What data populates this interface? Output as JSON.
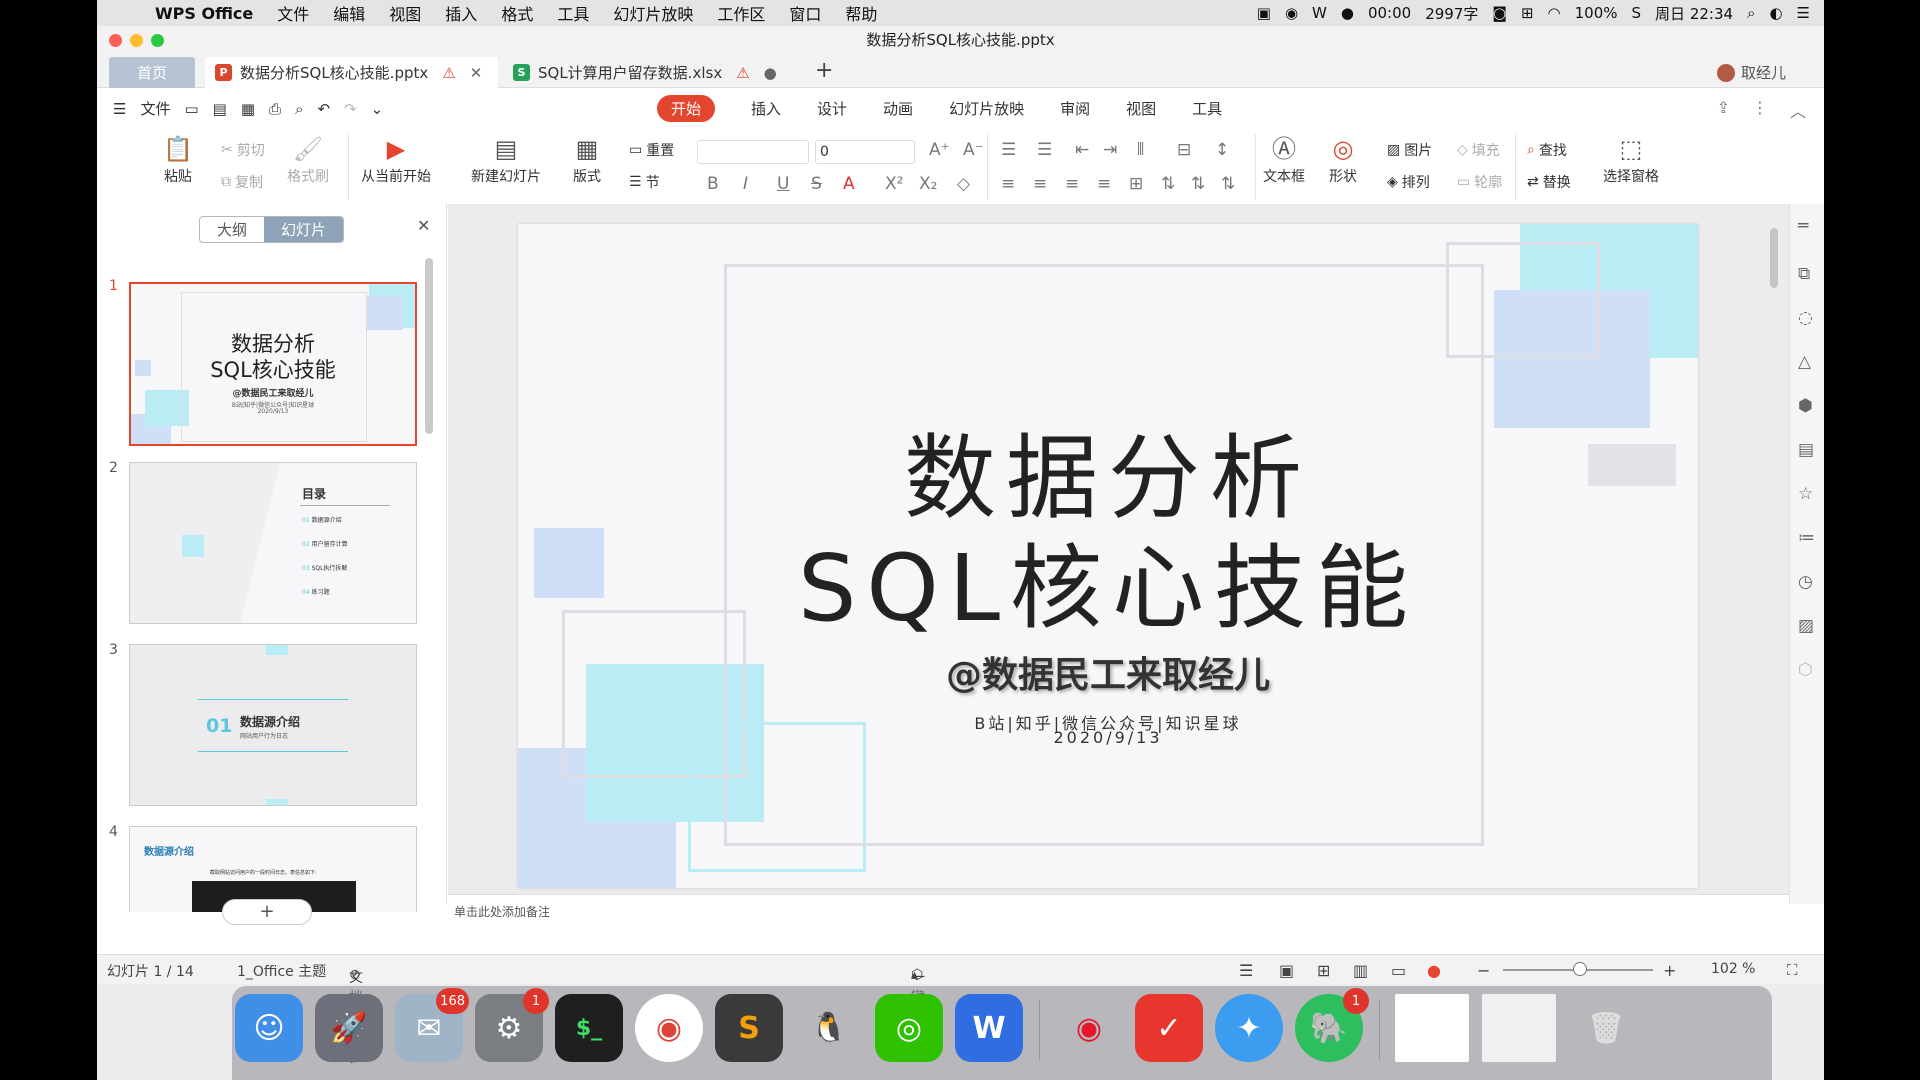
{
  "menubar": {
    "app": "WPS Office",
    "items": [
      "文件",
      "编辑",
      "视图",
      "插入",
      "格式",
      "工具",
      "幻灯片放映",
      "工作区",
      "窗口",
      "帮助"
    ],
    "timer": "00:00",
    "word_count": "2997字",
    "battery": "100%",
    "clock": "周日 22:34"
  },
  "window": {
    "title": "数据分析SQL核心技能.pptx"
  },
  "tabs": {
    "home": "首页",
    "ppt": "数据分析SQL核心技能.pptx",
    "xls": "SQL计算用户留存数据.xlsx",
    "user": "取经儿",
    "ppt_icon": "P",
    "xls_icon": "S"
  },
  "menu": {
    "file": "文件",
    "tabs": [
      "开始",
      "插入",
      "设计",
      "动画",
      "幻灯片放映",
      "审阅",
      "视图",
      "工具"
    ]
  },
  "ribbon": {
    "paste": "粘贴",
    "cut": "剪切",
    "copy": "复制",
    "format_painter": "格式刷",
    "from_current": "从当前开始",
    "new_slide": "新建幻灯片",
    "layout": "版式",
    "reset": "重置",
    "section": "节",
    "font_size": "0",
    "textbox": "文本框",
    "shape": "形状",
    "picture": "图片",
    "arrange": "排列",
    "fill": "填充",
    "outline": "轮廓",
    "find": "查找",
    "replace": "替换",
    "select_pane": "选择窗格"
  },
  "leftpanel": {
    "outline_tab": "大纲",
    "slides_tab": "幻灯片",
    "numbers": [
      "1",
      "2",
      "3",
      "4"
    ],
    "slide1": {
      "t1": "数据分析",
      "t2": "SQL核心技能",
      "author": "@数据民工来取经儿",
      "sub": "B站|知乎|微信公众号|知识星球",
      "date": "2020/9/13"
    },
    "slide2": {
      "title": "目录",
      "items": [
        [
          "01",
          "数据源介绍"
        ],
        [
          "02",
          "用户留存计算"
        ],
        [
          "03",
          "SQL执行拆解"
        ],
        [
          "04",
          "练习题"
        ]
      ]
    },
    "slide3": {
      "num": "01",
      "title": "数据源介绍",
      "sub": "网站用户行为日志"
    },
    "slide4": {
      "title": "数据源介绍",
      "desc": "截取网站访问用户的一段时间日志，表信息如下:"
    }
  },
  "slide": {
    "title1": "数据分析",
    "title2": "SQL核心技能",
    "author": "@数据民工来取经儿",
    "sub": "B站|知乎|微信公众号|知识星球",
    "date": "2020/9/13"
  },
  "notes": "单击此处添加备注",
  "status": {
    "slide_count": "幻灯片 1 / 14",
    "theme": "1_Office 主题",
    "protect": "文档未保护",
    "beautify": "一键美化",
    "zoom": "102 %"
  },
  "dock": {
    "badges": {
      "mail": "168",
      "prefs": "1",
      "evernote": "1"
    },
    "terminal": "$_",
    "wps": "W"
  },
  "colors": {
    "accent": "#e3452f",
    "cyan": "#b9ecf5",
    "blue": "#cfe0f6"
  }
}
